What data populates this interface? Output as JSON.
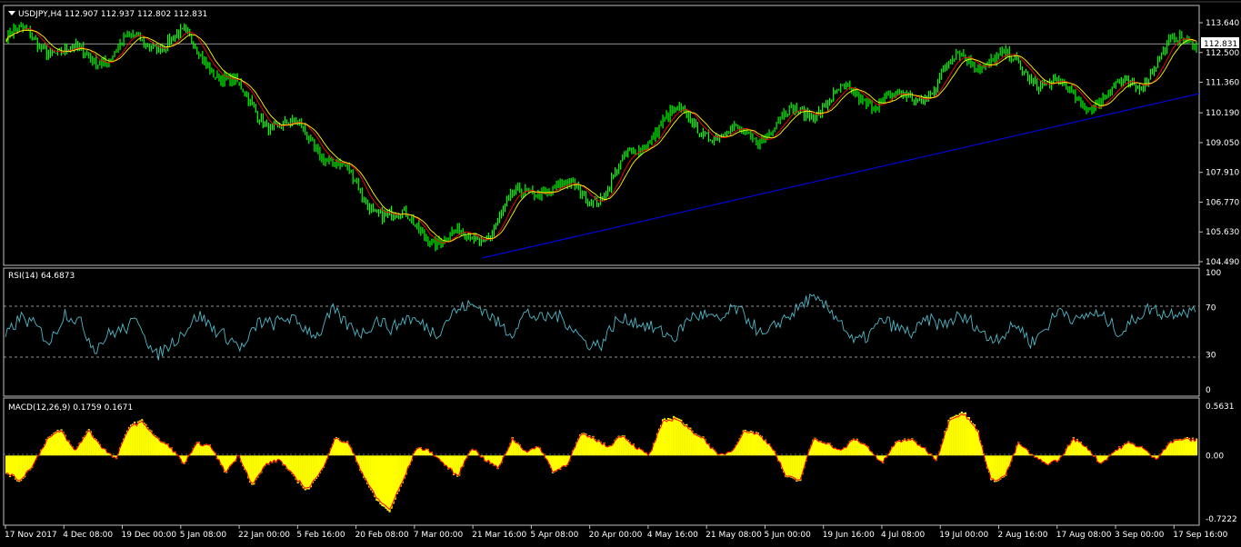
{
  "symbol_header": {
    "title": "USDJPY,H4  112.907 112.937 112.802 112.831",
    "current_price_label": "112.831"
  },
  "indicators": {
    "rsi_title": "RSI(14) 64.6873",
    "macd_title": "MACD(12,26,9) 0.1759 0.1671"
  },
  "colors": {
    "background": "#000000",
    "candle": "#00ff00",
    "ma_fast": "#ff0000",
    "ma_slow": "#ffff00",
    "trendline": "#0000ff",
    "rsi": "#4fb8c8",
    "macd_hist": "#ffff00",
    "macd_signal": "#ff0000"
  },
  "chart_data": [
    {
      "type": "line",
      "name": "USDJPY H4 price",
      "x": [
        "17 Nov 2017",
        "4 Dec 08:00",
        "19 Dec 00:00",
        "5 Jan 08:00",
        "22 Jan 00:00",
        "5 Feb 16:00",
        "20 Feb 08:00",
        "7 Mar 00:00",
        "21 Mar 16:00",
        "5 Apr 08:00",
        "20 Apr 00:00",
        "4 May 16:00",
        "21 May 08:00",
        "5 Jun 00:00",
        "19 Jun 16:00",
        "4 Jul 08:00",
        "19 Jul 00:00",
        "2 Aug 16:00",
        "17 Aug 08:00",
        "3 Sep 00:00",
        "17 Sep 16:00"
      ],
      "series": [
        {
          "values": [
            112.7,
            112.5,
            113.1,
            112.5,
            111.0,
            109.5,
            106.5,
            106.1,
            105.3,
            107.2,
            107.6,
            109.6,
            109.3,
            110.2,
            110.3,
            110.8,
            112.4,
            111.5,
            111.1,
            111.3,
            112.83
          ]
        }
      ],
      "y_ticks": [
        "113.640",
        "112.500",
        "111.360",
        "110.190",
        "109.050",
        "107.910",
        "106.770",
        "105.630",
        "104.490"
      ],
      "ylim": [
        104.49,
        113.64
      ],
      "trendline": {
        "from": [
          "21 Mar 16:00",
          104.6
        ],
        "to": [
          "end",
          111.0
        ]
      },
      "horizontal_line": 112.831
    },
    {
      "type": "line",
      "name": "RSI",
      "y_ticks": [
        "100",
        "70",
        "30",
        "0"
      ],
      "levels": [
        70,
        30
      ],
      "ylim": [
        0,
        100
      ],
      "values": [
        45,
        62,
        55,
        40,
        66,
        58,
        35,
        48,
        52,
        60,
        28,
        38,
        50,
        64,
        52,
        44,
        35,
        58,
        56,
        62,
        54,
        46,
        68,
        55,
        48,
        60,
        52,
        62,
        56,
        48,
        65,
        72,
        70,
        58,
        48,
        66,
        60,
        64,
        55,
        40,
        38,
        58,
        60,
        55,
        50,
        44,
        62,
        64,
        58,
        70,
        60,
        44,
        58,
        66,
        78,
        72,
        62,
        40,
        46,
        60,
        52,
        48,
        60,
        55,
        62,
        58,
        44,
        46,
        56,
        40,
        54,
        70,
        58,
        66,
        60,
        48,
        62,
        70,
        64,
        68,
        66
      ]
    },
    {
      "type": "area",
      "name": "MACD",
      "y_ticks": [
        "0.5631",
        "0.00",
        "-0.7222"
      ],
      "ylim": [
        -0.7222,
        0.5631
      ],
      "values": [
        -0.2,
        -0.3,
        -0.1,
        0.2,
        0.3,
        0.05,
        0.3,
        0.1,
        -0.05,
        0.35,
        0.4,
        0.2,
        0.1,
        -0.1,
        0.15,
        0.1,
        -0.2,
        0.0,
        -0.35,
        -0.1,
        -0.05,
        -0.25,
        -0.4,
        -0.2,
        0.2,
        0.15,
        -0.2,
        -0.5,
        -0.65,
        -0.3,
        0.1,
        0.05,
        -0.1,
        -0.25,
        0.1,
        -0.05,
        -0.15,
        0.2,
        0.05,
        0.1,
        -0.2,
        -0.1,
        0.25,
        0.2,
        0.1,
        0.25,
        0.1,
        0.0,
        0.4,
        0.45,
        0.3,
        0.2,
        0.0,
        0.05,
        0.3,
        0.25,
        0.1,
        -0.25,
        -0.3,
        0.2,
        0.15,
        0.05,
        0.2,
        0.1,
        -0.1,
        0.15,
        0.2,
        0.1,
        -0.05,
        0.45,
        0.5,
        0.3,
        -0.3,
        -0.25,
        0.15,
        0.0,
        -0.1,
        -0.05,
        0.2,
        0.1,
        -0.1,
        0.05,
        0.15,
        0.1,
        -0.05,
        0.15,
        0.2,
        0.18
      ]
    }
  ]
}
